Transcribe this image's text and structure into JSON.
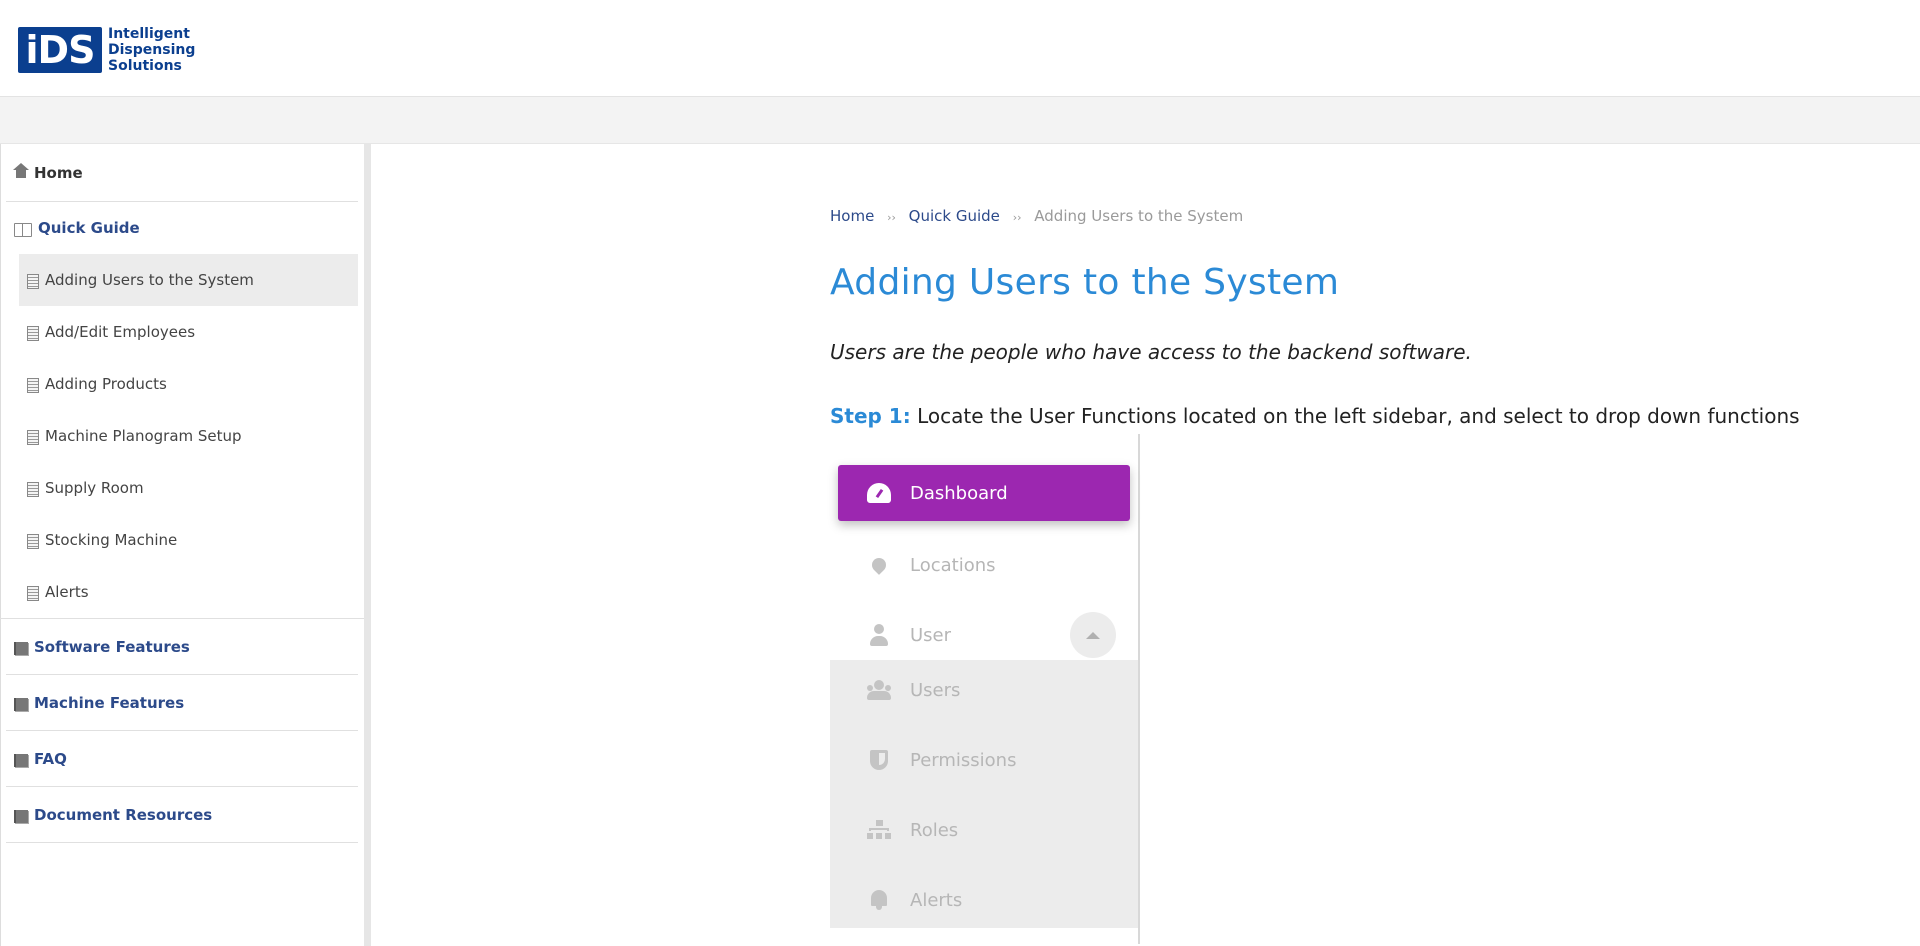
{
  "brand": {
    "logo_mark": "iDS",
    "logo_lines": [
      "Intelligent",
      "Dispensing",
      "Solutions"
    ],
    "color": "#0b3f8f"
  },
  "sidebar": {
    "home": {
      "label": "Home",
      "icon": "home-icon"
    },
    "quick_guide": {
      "label": "Quick Guide",
      "icon": "book-open-icon",
      "items": [
        {
          "label": "Adding Users to the System",
          "active": true
        },
        {
          "label": "Add/Edit Employees"
        },
        {
          "label": "Adding Products"
        },
        {
          "label": "Machine Planogram Setup"
        },
        {
          "label": "Supply Room"
        },
        {
          "label": "Stocking Machine"
        },
        {
          "label": "Alerts"
        }
      ]
    },
    "sections": [
      {
        "label": "Software Features",
        "icon": "book-icon"
      },
      {
        "label": "Machine Features",
        "icon": "book-icon"
      },
      {
        "label": "FAQ",
        "icon": "book-icon"
      },
      {
        "label": "Document Resources",
        "icon": "book-icon"
      }
    ]
  },
  "breadcrumb": {
    "home": "Home",
    "section": "Quick Guide",
    "current": "Adding Users to the System",
    "separator": "››"
  },
  "article": {
    "title": "Adding Users to the System",
    "lead": "Users are the people who have access to the backend software.",
    "step_label": "Step 1:",
    "step_text": " Locate the User Functions located on the left sidebar, and select to drop down functions"
  },
  "figure": {
    "menu": [
      {
        "label": "Dashboard",
        "icon": "dashboard-gauge-icon",
        "active": true
      },
      {
        "label": "Locations",
        "icon": "map-pin-icon"
      },
      {
        "label": "User",
        "icon": "user-icon"
      }
    ],
    "submenu": [
      {
        "label": "Users",
        "icon": "users-icon"
      },
      {
        "label": "Permissions",
        "icon": "shield-icon"
      },
      {
        "label": "Roles",
        "icon": "sitemap-icon"
      },
      {
        "label": "Alerts",
        "icon": "bell-icon"
      }
    ],
    "accent": "#9c27b0"
  },
  "colors": {
    "title": "#2b8ad6",
    "nav_link": "#2c4a8a"
  }
}
